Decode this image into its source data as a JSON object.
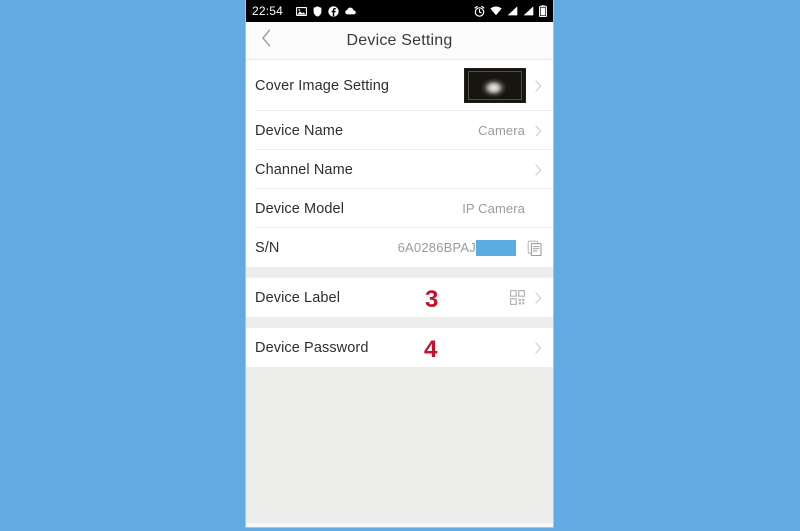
{
  "theme": {
    "page_background": "#62abe2",
    "screen_background": "#ededeb",
    "card_background": "#ffffff",
    "accent_redaction": "#5aade2",
    "annotation_color": "#c8102e",
    "label_color": "#2e2e2e",
    "value_color": "#9b9b9b"
  },
  "status_bar": {
    "time": "22:54",
    "left_icons": [
      "gallery-icon",
      "shield-icon",
      "facebook-icon",
      "cloud-icon"
    ],
    "right_icons": [
      "alarm-icon",
      "wifi-icon",
      "signal-icon",
      "signal-2-icon",
      "battery-icon"
    ]
  },
  "header": {
    "back_icon": "chevron-left-icon",
    "title": "Device Setting"
  },
  "settings": {
    "group_1": [
      {
        "label": "Cover Image Setting",
        "value": "",
        "accessory": "thumbnail",
        "chevron": true
      },
      {
        "label": "Device Name",
        "value": "Camera",
        "accessory": "value",
        "chevron": true
      },
      {
        "label": "Channel Name",
        "value": "",
        "accessory": "none",
        "chevron": true
      },
      {
        "label": "Device Model",
        "value": "IP Camera",
        "accessory": "value",
        "chevron": false
      },
      {
        "label": "S/N",
        "value": "6A0286BPAJ",
        "accessory": "serial",
        "chevron": false,
        "copy_icon": "copy-icon",
        "redacted": true
      }
    ],
    "group_2": [
      {
        "label": "Device Label",
        "value": "",
        "accessory": "qr",
        "chevron": true,
        "qr_icon": "qr-code-icon",
        "annotation": "3"
      }
    ],
    "group_3": [
      {
        "label": "Device Password",
        "value": "",
        "accessory": "none",
        "chevron": true,
        "annotation": "4"
      }
    ]
  }
}
